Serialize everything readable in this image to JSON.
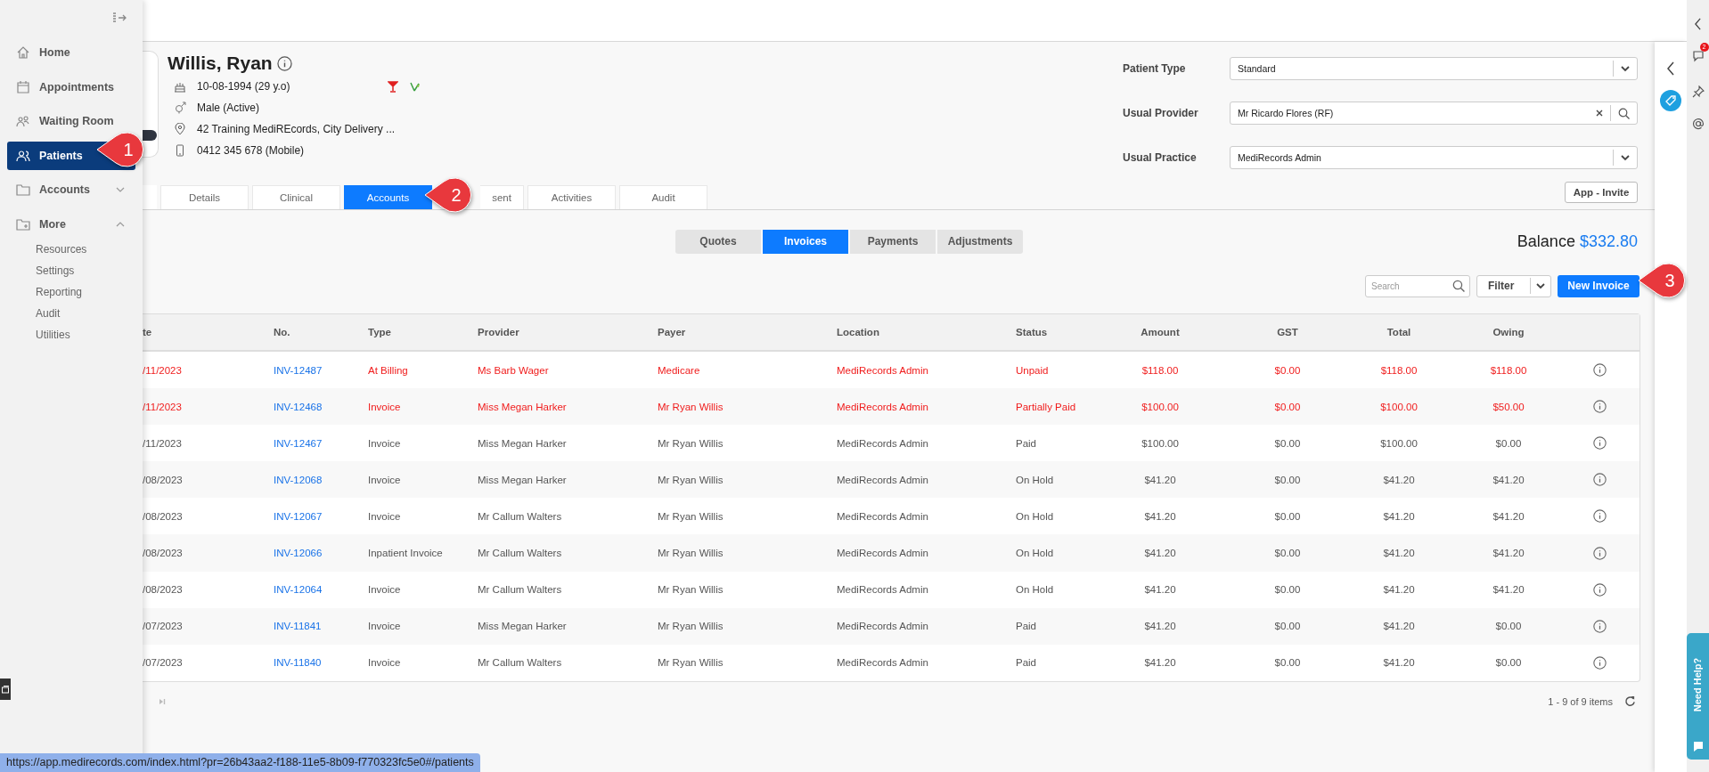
{
  "sidebar": {
    "items": [
      {
        "label": "Home",
        "kind": "link",
        "selected": false
      },
      {
        "label": "Appointments",
        "kind": "link",
        "selected": false
      },
      {
        "label": "Waiting Room",
        "kind": "link",
        "selected": false
      },
      {
        "label": "Patients",
        "kind": "link",
        "selected": true
      },
      {
        "label": "Accounts",
        "kind": "group",
        "selected": false,
        "expanded": false
      },
      {
        "label": "More",
        "kind": "group",
        "selected": false,
        "expanded": true,
        "children": [
          {
            "label": "Resources"
          },
          {
            "label": "Settings"
          },
          {
            "label": "Reporting"
          },
          {
            "label": "Audit"
          },
          {
            "label": "Utilities"
          }
        ]
      }
    ]
  },
  "patient": {
    "name": "Willis, Ryan",
    "dob": "10-08-1994 (29 y.o)",
    "gender": "Male (Active)",
    "address": "42 Training MediREcords, City Delivery ...",
    "phone": "0412 345 678 (Mobile)"
  },
  "fields": [
    {
      "label": "Patient Type",
      "value": "Standard",
      "kind": "select"
    },
    {
      "label": "Usual Provider",
      "value": "Mr Ricardo Flores (RF)",
      "kind": "lookup"
    },
    {
      "label": "Usual Practice",
      "value": "MediRecords Admin",
      "kind": "select"
    }
  ],
  "app_invite_button": "App - Invite",
  "tabs": [
    {
      "label": "Details",
      "selected": false
    },
    {
      "label": "Clinical",
      "selected": false
    },
    {
      "label": "Accounts",
      "selected": true
    },
    {
      "label": "sent",
      "selected": false
    },
    {
      "label": "Activities",
      "selected": false
    },
    {
      "label": "Audit",
      "selected": false
    }
  ],
  "subtabs": [
    {
      "label": "Quotes",
      "selected": false
    },
    {
      "label": "Invoices",
      "selected": true
    },
    {
      "label": "Payments",
      "selected": false
    },
    {
      "label": "Adjustments",
      "selected": false
    }
  ],
  "balance": {
    "label": "Balance",
    "amount": "$332.80"
  },
  "toolbar": {
    "search_placeholder": "Search",
    "filter": "Filter",
    "new_button": "New Invoice"
  },
  "table": {
    "columns": [
      "te",
      "No.",
      "Type",
      "Provider",
      "Payer",
      "Location",
      "Status",
      "Amount",
      "GST",
      "Total",
      "Owing"
    ],
    "rows": [
      {
        "date": "/11/2023",
        "number": "INV-12487",
        "type": "At Billing",
        "provider": "Ms Barb Wager",
        "payer": "Medicare",
        "location": "MediRecords Admin",
        "status": "Unpaid",
        "amount": "$118.00",
        "gst": "$0.00",
        "total": "$118.00",
        "owing": "$118.00",
        "alert": true
      },
      {
        "date": "/11/2023",
        "number": "INV-12468",
        "type": "Invoice",
        "provider": "Miss Megan Harker",
        "payer": "Mr Ryan Willis",
        "location": "MediRecords Admin",
        "status": "Partially Paid",
        "amount": "$100.00",
        "gst": "$0.00",
        "total": "$100.00",
        "owing": "$50.00",
        "alert": true
      },
      {
        "date": "/11/2023",
        "number": "INV-12467",
        "type": "Invoice",
        "provider": "Miss Megan Harker",
        "payer": "Mr Ryan Willis",
        "location": "MediRecords Admin",
        "status": "Paid",
        "amount": "$100.00",
        "gst": "$0.00",
        "total": "$100.00",
        "owing": "$0.00",
        "alert": false
      },
      {
        "date": "/08/2023",
        "number": "INV-12068",
        "type": "Invoice",
        "provider": "Miss Megan Harker",
        "payer": "Mr Ryan Willis",
        "location": "MediRecords Admin",
        "status": "On Hold",
        "amount": "$41.20",
        "gst": "$0.00",
        "total": "$41.20",
        "owing": "$41.20",
        "alert": false
      },
      {
        "date": "/08/2023",
        "number": "INV-12067",
        "type": "Invoice",
        "provider": "Mr Callum Walters",
        "payer": "Mr Ryan Willis",
        "location": "MediRecords Admin",
        "status": "On Hold",
        "amount": "$41.20",
        "gst": "$0.00",
        "total": "$41.20",
        "owing": "$41.20",
        "alert": false
      },
      {
        "date": "/08/2023",
        "number": "INV-12066",
        "type": "Inpatient Invoice",
        "provider": "Mr Callum Walters",
        "payer": "Mr Ryan Willis",
        "location": "MediRecords Admin",
        "status": "On Hold",
        "amount": "$41.20",
        "gst": "$0.00",
        "total": "$41.20",
        "owing": "$41.20",
        "alert": false
      },
      {
        "date": "/08/2023",
        "number": "INV-12064",
        "type": "Invoice",
        "provider": "Mr Callum Walters",
        "payer": "Mr Ryan Willis",
        "location": "MediRecords Admin",
        "status": "On Hold",
        "amount": "$41.20",
        "gst": "$0.00",
        "total": "$41.20",
        "owing": "$41.20",
        "alert": false
      },
      {
        "date": "/07/2023",
        "number": "INV-11841",
        "type": "Invoice",
        "provider": "Miss Megan Harker",
        "payer": "Mr Ryan Willis",
        "location": "MediRecords Admin",
        "status": "Paid",
        "amount": "$41.20",
        "gst": "$0.00",
        "total": "$41.20",
        "owing": "$0.00",
        "alert": false
      },
      {
        "date": "/07/2023",
        "number": "INV-11840",
        "type": "Invoice",
        "provider": "Mr Callum Walters",
        "payer": "Mr Ryan Willis",
        "location": "MediRecords Admin",
        "status": "Paid",
        "amount": "$41.20",
        "gst": "$0.00",
        "total": "$41.20",
        "owing": "$0.00",
        "alert": false
      }
    ]
  },
  "pager": "1 - 9 of 9 items",
  "notifications_badge": "2",
  "need_help": "Need Help?",
  "status_url": "https://app.medirecords.com/index.html?pr=26b43aa2-f188-11e5-8b09-f770323fc5e0#/patients",
  "callouts": [
    {
      "label": "1"
    },
    {
      "label": "2"
    },
    {
      "label": "3"
    }
  ]
}
